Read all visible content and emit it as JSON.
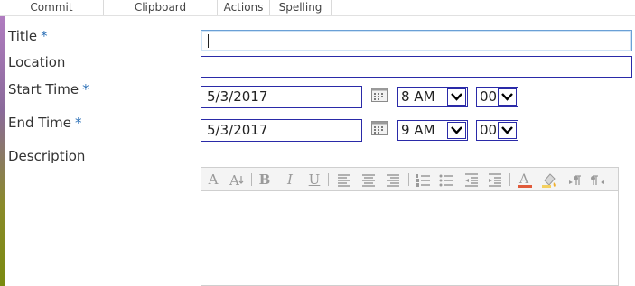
{
  "ribbon": {
    "groups": [
      "Commit",
      "Clipboard",
      "Actions",
      "Spelling"
    ]
  },
  "form": {
    "title_label": "Title",
    "location_label": "Location",
    "start_label": "Start Time",
    "end_label": "End Time",
    "description_label": "Description",
    "required_marker": "*",
    "title_value": "",
    "location_value": "",
    "start_date": "5/3/2017",
    "start_hour": "8 AM",
    "start_minute": "00",
    "end_date": "5/3/2017",
    "end_hour": "9 AM",
    "end_minute": "00"
  },
  "editor": {
    "toolbar_icons": [
      "font-size-increase-icon",
      "font-size-decrease-icon",
      "bold-icon",
      "italic-icon",
      "underline-icon",
      "align-left-icon",
      "align-center-icon",
      "align-right-icon",
      "numbered-list-icon",
      "bulleted-list-icon",
      "decrease-indent-icon",
      "increase-indent-icon",
      "text-color-icon",
      "highlight-color-icon",
      "ltr-icon",
      "rtl-icon"
    ],
    "bold_glyph": "B",
    "italic_glyph": "I",
    "underline_glyph": "U",
    "font_glyph": "A",
    "text_color": "#e05a3a",
    "content": ""
  },
  "colors": {
    "field_border": "#2a2aa8",
    "required": "#2b6fb6",
    "accent_top": "#b07cc0",
    "accent_bottom": "#7a8a10"
  }
}
